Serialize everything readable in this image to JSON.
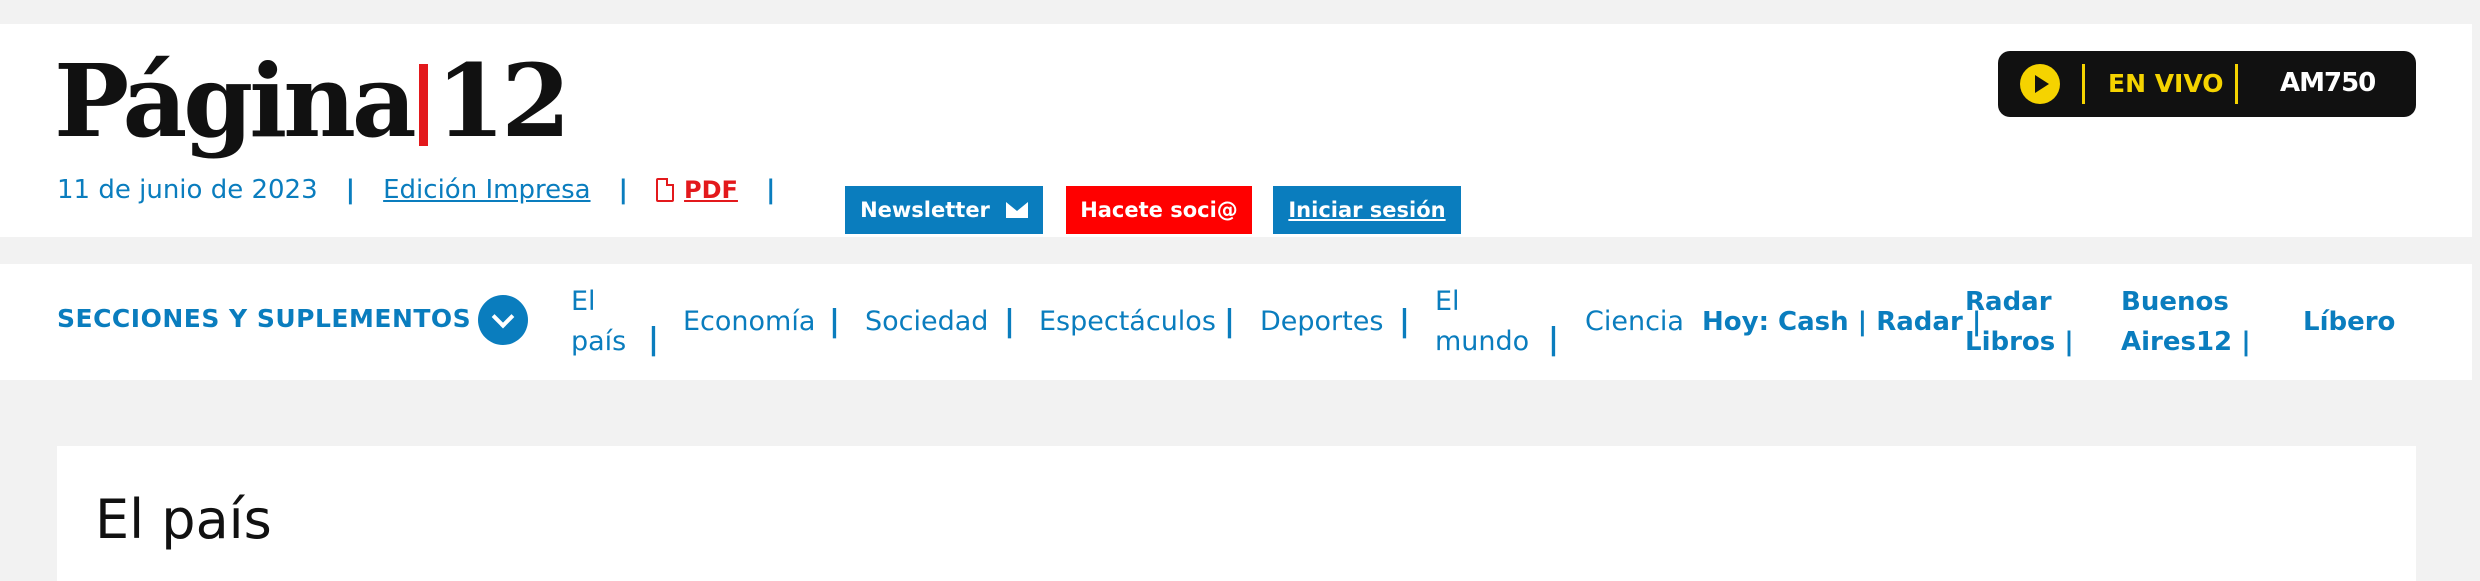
{
  "header": {
    "logo": {
      "left": "Página",
      "right": "12"
    },
    "date": "11 de junio de 2023",
    "edition_link": "Edición Impresa",
    "pdf_link": "PDF",
    "separator": "|",
    "newsletter_label": "Newsletter",
    "socio_label": "Hacete soci@",
    "login_label": "Iniciar sesión",
    "live": {
      "label": "EN VIVO",
      "station": "AM750"
    }
  },
  "nav": {
    "sections_label": "SECCIONES Y SUPLEMENTOS",
    "items": [
      {
        "line1": "El",
        "line2": "país"
      },
      {
        "label": "Economía"
      },
      {
        "label": "Sociedad"
      },
      {
        "label": "Espectáculos"
      },
      {
        "label": "Deportes"
      },
      {
        "line1": "El",
        "line2": "mundo"
      },
      {
        "label": "Ciencia"
      }
    ],
    "supplements": {
      "hoy": "Hoy: Cash | Radar |",
      "radar_libros_1": "Radar",
      "radar_libros_2": "Libros |",
      "buenos_aires_1": "Buenos",
      "buenos_aires_2": "Aires12 |",
      "libero": "Líbero"
    }
  },
  "main": {
    "section_title": "El país"
  },
  "colors": {
    "accent_blue": "#0a7dbe",
    "brand_red": "#e3191c",
    "cta_red": "#ff0000",
    "live_yellow": "#f5d300"
  }
}
